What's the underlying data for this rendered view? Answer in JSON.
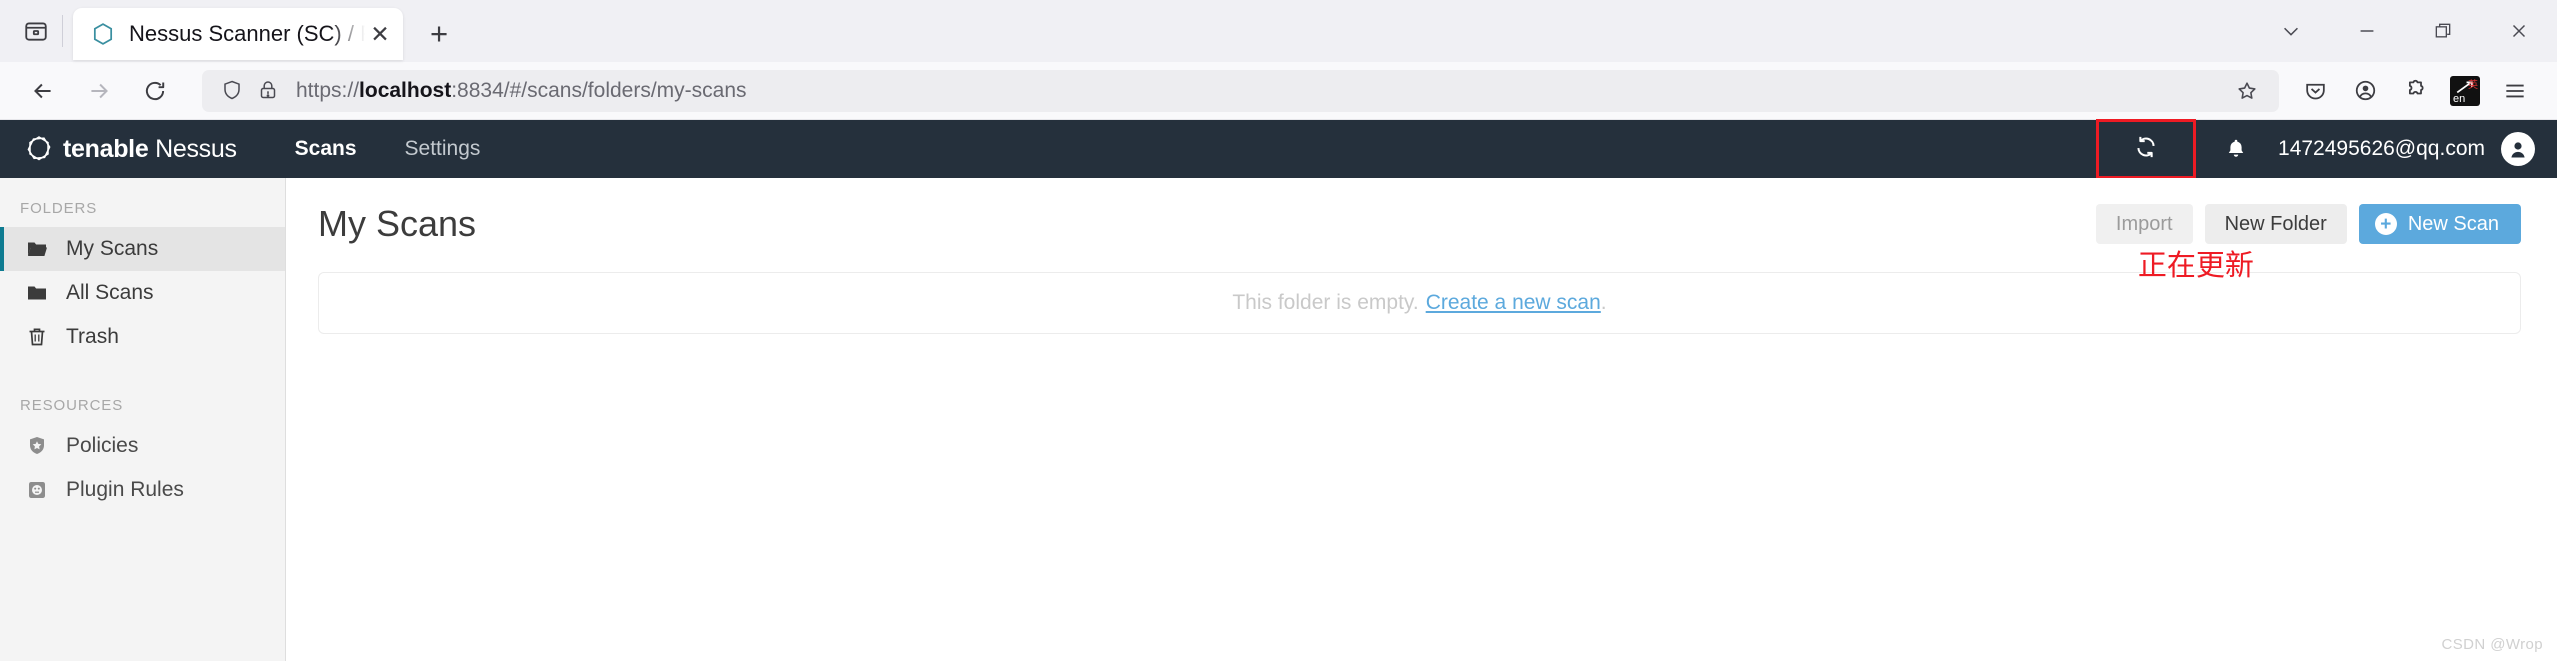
{
  "browser": {
    "tab": {
      "title": "Nessus Scanner (SC) / Folders",
      "favicon_name": "nessus-hexagon-favicon",
      "close_glyph": "✕"
    },
    "newtab_glyph": "+",
    "window_controls": {
      "tab_list_glyph": "⌄",
      "minimize_glyph": "—",
      "restore_glyph": "❐",
      "close_glyph": "✕"
    },
    "nav": {
      "back_glyph": "←",
      "forward_glyph": "→",
      "reload_glyph": "⟳"
    },
    "url": {
      "scheme": "https://",
      "host": "localhost",
      "rest": ":8834/#/scans/folders/my-scans",
      "full": "https://localhost:8834/#/scans/folders/my-scans"
    },
    "toolbar_icons": [
      "pocket-icon",
      "account-icon",
      "extensions-puzzle-icon",
      "translate-extension-icon",
      "app-menu-hamburger-icon"
    ],
    "extension_badge": {
      "label_en": "en",
      "label_cn": "英"
    }
  },
  "app_header": {
    "brand_bold": "tenable",
    "brand_light": "Nessus",
    "nav": [
      {
        "label": "Scans",
        "active": true
      },
      {
        "label": "Settings",
        "active": false
      }
    ],
    "refresh_icon_name": "refresh-icon",
    "notification_icon_name": "bell-icon",
    "user_email": "1472495626@qq.com",
    "avatar_icon_name": "user-avatar-icon",
    "highlight_color": "#ee1b24",
    "bar_color": "#25303c"
  },
  "sidebar": {
    "sections": [
      {
        "title": "FOLDERS",
        "items": [
          {
            "label": "My Scans",
            "icon": "folder-open-icon",
            "active": true
          },
          {
            "label": "All Scans",
            "icon": "folder-icon",
            "active": false
          },
          {
            "label": "Trash",
            "icon": "trash-icon",
            "active": false
          }
        ]
      },
      {
        "title": "RESOURCES",
        "items": [
          {
            "label": "Policies",
            "icon": "shield-star-icon",
            "active": false
          },
          {
            "label": "Plugin Rules",
            "icon": "plugin-outlet-icon",
            "active": false
          }
        ]
      }
    ],
    "active_accent": "#0e7b91"
  },
  "main": {
    "page_title": "My Scans",
    "buttons": {
      "import": "Import",
      "new_folder": "New Folder",
      "new_scan": "New Scan",
      "new_scan_plus_glyph": "+"
    },
    "annotation": "正在更新",
    "empty_state": {
      "message": "This folder is empty.",
      "link": "Create a new scan",
      "trailing": "."
    },
    "primary_color": "#5ca9dd"
  },
  "watermark": "CSDN @Wrop"
}
